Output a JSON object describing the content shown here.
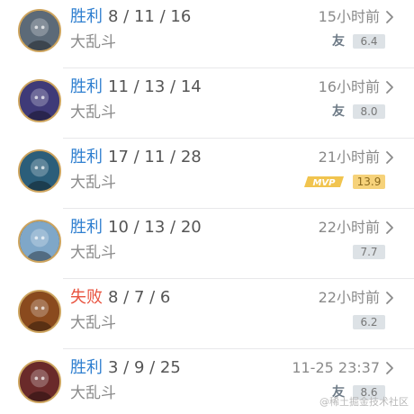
{
  "matches": [
    {
      "result": "胜利",
      "lose": false,
      "kda": "8 / 11 / 16",
      "mode": "大乱斗",
      "time": "15小时前",
      "badge": "you",
      "badge_text": "友",
      "score": "6.4",
      "avatar_color": "#5c6a78"
    },
    {
      "result": "胜利",
      "lose": false,
      "kda": "11 / 13 / 14",
      "mode": "大乱斗",
      "time": "16小时前",
      "badge": "you",
      "badge_text": "友",
      "score": "8.0",
      "avatar_color": "#3f3a78"
    },
    {
      "result": "胜利",
      "lose": false,
      "kda": "17 / 11 / 28",
      "mode": "大乱斗",
      "time": "21小时前",
      "badge": "mvp",
      "badge_text": "MVP",
      "score": "13.9",
      "avatar_color": "#2b5e7a"
    },
    {
      "result": "胜利",
      "lose": false,
      "kda": "10 / 13 / 20",
      "mode": "大乱斗",
      "time": "22小时前",
      "badge": "",
      "badge_text": "",
      "score": "7.7",
      "avatar_color": "#7fa7c8"
    },
    {
      "result": "失败",
      "lose": true,
      "kda": "8 / 7 / 6",
      "mode": "大乱斗",
      "time": "22小时前",
      "badge": "",
      "badge_text": "",
      "score": "6.2",
      "avatar_color": "#8a4a1e"
    },
    {
      "result": "胜利",
      "lose": false,
      "kda": "3 / 9 / 25",
      "mode": "大乱斗",
      "time": "11-25 23:37",
      "badge": "you",
      "badge_text": "友",
      "score": "8.6",
      "avatar_color": "#6a2a2a"
    }
  ],
  "watermark": "@稀土掘金技术社区",
  "colors": {
    "win": "#2f7fd0",
    "lose": "#e8533f",
    "avatar_ring": "#cda45e"
  }
}
